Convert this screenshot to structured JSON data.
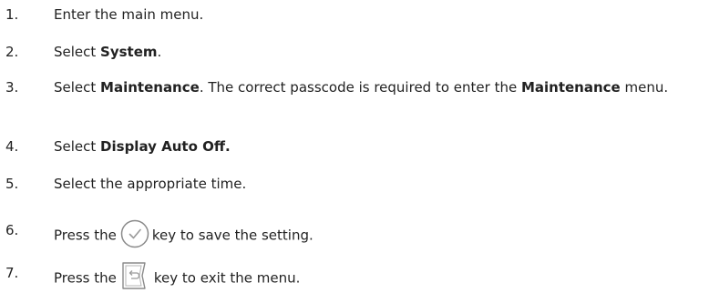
{
  "steps": [
    {
      "number": "1.",
      "parts": [
        {
          "text": "Enter the main menu."
        }
      ]
    },
    {
      "number": "2.",
      "parts": [
        {
          "text": "Select "
        },
        {
          "text": "System",
          "bold": true
        },
        {
          "text": "."
        }
      ]
    },
    {
      "number": "3.",
      "parts": [
        {
          "text": "Select "
        },
        {
          "text": "Maintenance",
          "bold": true
        },
        {
          "text": ". The correct passcode is required to enter the "
        },
        {
          "text": "Maintenance",
          "bold": true
        },
        {
          "text": " menu."
        }
      ]
    },
    {
      "number": "4.",
      "parts": [
        {
          "text": "Select "
        },
        {
          "text": "Display Auto Off.",
          "bold": true
        }
      ]
    },
    {
      "number": "5.",
      "parts": [
        {
          "text": "Select the appropriate time."
        }
      ]
    },
    {
      "number": "6.",
      "before": "Press the",
      "icon": "confirm-check-key-icon",
      "after": "key to save the setting."
    },
    {
      "number": "7.",
      "before": "Press the",
      "icon": "back-return-key-icon",
      "after": "key to exit the menu."
    }
  ],
  "icon_colors": {
    "outline": "#8a8a8a",
    "fill": "#ffffff"
  }
}
